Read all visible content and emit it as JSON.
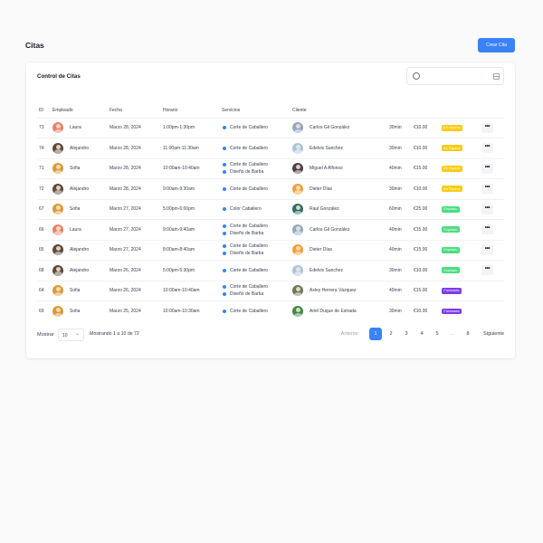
{
  "header": {
    "title": "Citas",
    "create_button": "Crear Cita"
  },
  "card": {
    "title": "Control de Citas"
  },
  "colors": {
    "accent": "#3b82f6",
    "espera": "#facc15",
    "expirado": "#4ade80",
    "facturado": "#7c3aed"
  },
  "table": {
    "columns": [
      "ID",
      "Empleado",
      "Fecha",
      "Horario",
      "Servicios",
      "Cliente"
    ],
    "rows": [
      {
        "id": "73",
        "employee": "Laura",
        "date": "Marzo 28, 2024",
        "time": "1:00pm-1:30pm",
        "services": [
          "Corte de Caballero"
        ],
        "client": "Carlos Gil González",
        "duration": "30min",
        "price": "€10.00",
        "status": "En Espera",
        "status_type": "espera"
      },
      {
        "id": "74",
        "employee": "Alejandro",
        "date": "Marzo 28, 2024",
        "time": "11:00am-11:30am",
        "services": [
          "Corte de Caballero"
        ],
        "client": "Edelvis Sanchez",
        "duration": "30min",
        "price": "€10.00",
        "status": "En Espera",
        "status_type": "espera"
      },
      {
        "id": "71",
        "employee": "Sofia",
        "date": "Marzo 28, 2024",
        "time": "10:00am-10:40am",
        "services": [
          "Corte de Caballero",
          "Diseño de Barba"
        ],
        "client": "Miguel A Alfonso",
        "duration": "40min",
        "price": "€15.00",
        "status": "En Espera",
        "status_type": "espera"
      },
      {
        "id": "72",
        "employee": "Alejandro",
        "date": "Marzo 28, 2024",
        "time": "9:00am-9:30am",
        "services": [
          "Corte de Caballero"
        ],
        "client": "Dieter Días",
        "duration": "30min",
        "price": "€10.00",
        "status": "En Espera",
        "status_type": "espera"
      },
      {
        "id": "67",
        "employee": "Sofia",
        "date": "Marzo 27, 2024",
        "time": "5:00pm-6:00pm",
        "services": [
          "Color Caballero"
        ],
        "client": "Raul González",
        "duration": "60min",
        "price": "€25.00",
        "status": "Expirado",
        "status_type": "expirado"
      },
      {
        "id": "66",
        "employee": "Laura",
        "date": "Marzo 27, 2024",
        "time": "9:00am-9:40am",
        "services": [
          "Corte de Caballero",
          "Diseño de Barba"
        ],
        "client": "Carlos Gil González",
        "duration": "40min",
        "price": "€15.00",
        "status": "Expirado",
        "status_type": "expirado"
      },
      {
        "id": "65",
        "employee": "Alejandro",
        "date": "Marzo 27, 2024",
        "time": "8:00am-8:40am",
        "services": [
          "Corte de Caballero",
          "Diseño de Barba"
        ],
        "client": "Dieter Días",
        "duration": "40min",
        "price": "€15.00",
        "status": "Expirado",
        "status_type": "expirado"
      },
      {
        "id": "68",
        "employee": "Alejandro",
        "date": "Marzo 26, 2024",
        "time": "5:00pm-5:30pm",
        "services": [
          "Corte de Caballero"
        ],
        "client": "Edelvis Sanchez",
        "duration": "30min",
        "price": "€10.00",
        "status": "Expirado",
        "status_type": "expirado"
      },
      {
        "id": "64",
        "employee": "Sofia",
        "date": "Marzo 26, 2024",
        "time": "10:00am-10:40am",
        "services": [
          "Corte de Caballero",
          "Diseño de Barba"
        ],
        "client": "Axley Herrera Vázquez",
        "duration": "40min",
        "price": "€15.00",
        "status": "Facturada",
        "status_type": "facturado"
      },
      {
        "id": "69",
        "employee": "Sofia",
        "date": "Marzo 25, 2024",
        "time": "10:00am-10:30am",
        "services": [
          "Corte de Caballero"
        ],
        "client": "Ariel Duque de Estrada",
        "duration": "30min",
        "price": "€10.00",
        "status": "Facturada",
        "status_type": "facturado"
      }
    ]
  },
  "footer": {
    "show_label": "Mostrar",
    "page_size": "10",
    "showing_info": "Mostrando 1 a 10 de 72",
    "pagination": {
      "prev": "Anterior",
      "pages": [
        "1",
        "2",
        "3",
        "4",
        "5",
        "...",
        "8"
      ],
      "current": "1",
      "next": "Siguiente"
    }
  },
  "avatars": {
    "employees": {
      "Laura": "#e8826b",
      "Alejandro": "#5b4a3f",
      "Sofia": "#d89a3a"
    },
    "clients": {
      "Carlos Gil González": "#8fa8c8",
      "Edelvis Sanchez": "#a8c4e0",
      "Miguel A Alfonso": "#4a3f4d",
      "Dieter Días": "#f59e3b",
      "Raul González": "#2c6e6a",
      "Axley Herrera Vázquez": "#6b7a5a",
      "Ariel Duque de Estrada": "#3f8a4a"
    }
  }
}
